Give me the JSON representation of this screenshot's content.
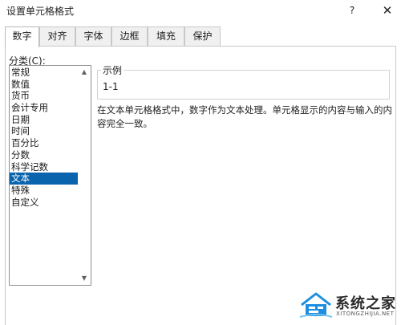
{
  "window": {
    "title": "设置单元格格式",
    "help_glyph": "?",
    "close_glyph": "✕"
  },
  "tabs": [
    {
      "label": "数字",
      "active": true
    },
    {
      "label": "对齐"
    },
    {
      "label": "字体"
    },
    {
      "label": "边框"
    },
    {
      "label": "填充"
    },
    {
      "label": "保护"
    }
  ],
  "category": {
    "label": "分类(C):",
    "items": [
      "常规",
      "数值",
      "货币",
      "会计专用",
      "日期",
      "时间",
      "百分比",
      "分数",
      "科学记数",
      "文本",
      "特殊",
      "自定义"
    ],
    "selected": "文本"
  },
  "sample": {
    "title": "示例",
    "value": "1-1"
  },
  "description": "在文本单元格格式中，数字作为文本处理。单元格显示的内容与输入的内容完全一致。",
  "watermark": {
    "name": "系统之家",
    "domain": "XITONGZHIJIA.NET"
  },
  "colors": {
    "selection": "#0a64ad",
    "watermark_blue": "#1e8fe0"
  }
}
